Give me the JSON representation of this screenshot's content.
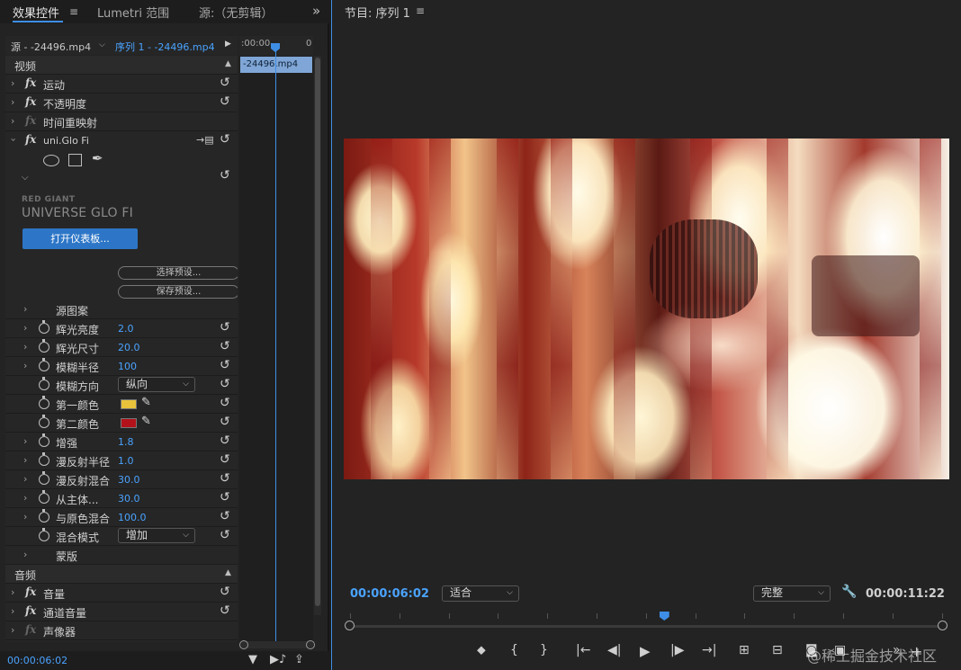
{
  "left_panel": {
    "tabs": [
      {
        "label": "效果控件",
        "active": true
      },
      {
        "label": "Lumetri 范围"
      },
      {
        "label": "源:（无剪辑）"
      }
    ],
    "menu_glyph": "≡",
    "overflow_glyph": "»",
    "source_label": "源 - -24496.mp4",
    "sequence_label": "序列 1 - -24496.mp4",
    "mini_timeline": {
      "start": ":00:00",
      "end": "0",
      "clip_label": "-24496.mp4"
    },
    "sections": {
      "video": "视频",
      "audio": "音频"
    },
    "video_effects": [
      {
        "label": "运动"
      },
      {
        "label": "不透明度"
      },
      {
        "label": "时间重映射"
      },
      {
        "label": "uni.Glo Fi"
      }
    ],
    "plugin": {
      "brand": "RED GIANT",
      "product": "UNIVERSE GLO FI",
      "open_dashboard": "打开仪表板...",
      "select_preset": "选择预设...",
      "save_preset": "保存预设..."
    },
    "params": [
      {
        "label": "源图案"
      },
      {
        "label": "辉光亮度",
        "value": "2.0"
      },
      {
        "label": "辉光尺寸",
        "value": "20.0"
      },
      {
        "label": "模糊半径",
        "value": "100"
      },
      {
        "label": "模糊方向",
        "dropdown": "纵向"
      },
      {
        "label": "第一颜色",
        "color": "#e8c23a"
      },
      {
        "label": "第二颜色",
        "color": "#b3121a"
      },
      {
        "label": "增强",
        "value": "1.8"
      },
      {
        "label": "漫反射半径",
        "value": "1.0"
      },
      {
        "label": "漫反射混合",
        "value": "30.0"
      },
      {
        "label": "从主体...",
        "value": "30.0"
      },
      {
        "label": "与原色混合",
        "value": "100.0"
      },
      {
        "label": "混合模式",
        "dropdown": "增加"
      },
      {
        "label": "蒙版"
      }
    ],
    "audio_effects": [
      {
        "label": "音量"
      },
      {
        "label": "通道音量"
      },
      {
        "label": "声像器"
      }
    ],
    "footer_timecode": "00:00:06:02"
  },
  "program_monitor": {
    "title": "节目: 序列 1",
    "menu_glyph": "≡",
    "current_timecode": "00:00:06:02",
    "fit_label": "适合",
    "quality_label": "完整",
    "duration": "00:00:11:22",
    "playhead_fraction": 0.53
  },
  "watermark": "@稀土掘金技术社区",
  "colors": {
    "accent": "#3f8ee6",
    "value_blue": "#4aa3ff"
  }
}
